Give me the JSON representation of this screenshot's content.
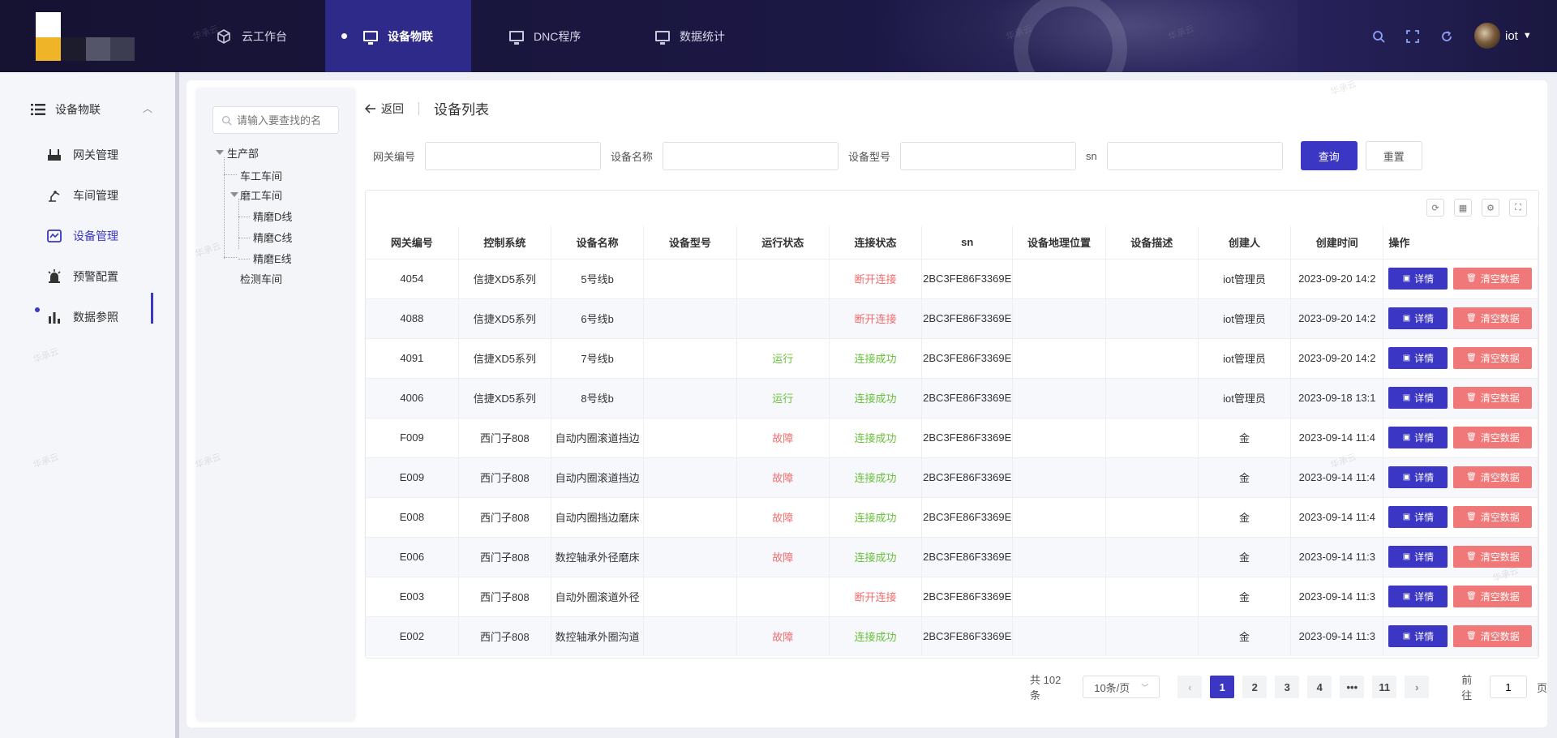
{
  "header": {
    "nav": [
      {
        "label": "云工作台",
        "icon": "cube-icon"
      },
      {
        "label": "设备物联",
        "icon": "monitor-icon",
        "active": true
      },
      {
        "label": "DNC程序",
        "icon": "monitor-icon"
      },
      {
        "label": "数据统计",
        "icon": "monitor-icon"
      }
    ],
    "icons": [
      "search-icon",
      "fullscreen-icon",
      "refresh-icon"
    ],
    "user": "iot"
  },
  "sidebar": {
    "group": "设备物联",
    "items": [
      {
        "label": "网关管理",
        "icon": "gateway-icon"
      },
      {
        "label": "车间管理",
        "icon": "robot-arm-icon"
      },
      {
        "label": "设备管理",
        "icon": "device-icon",
        "active": true
      },
      {
        "label": "预警配置",
        "icon": "alarm-icon"
      },
      {
        "label": "数据参照",
        "icon": "bar-chart-icon"
      }
    ]
  },
  "tree": {
    "search_placeholder": "请输入要查找的名",
    "nodes": [
      "生产部",
      "车工车间",
      "磨工车间",
      "精磨D线",
      "精磨C线",
      "精磨E线",
      "检测车间"
    ]
  },
  "breadcrumb": {
    "back": "返回",
    "title": "设备列表"
  },
  "filters": {
    "gateway_no": "网关编号",
    "device_name": "设备名称",
    "device_model": "设备型号",
    "sn": "sn",
    "query": "查询",
    "reset": "重置"
  },
  "table": {
    "columns": [
      "网关编号",
      "控制系统",
      "设备名称",
      "设备型号",
      "运行状态",
      "连接状态",
      "sn",
      "设备地理位置",
      "设备描述",
      "创建人",
      "创建时间",
      "操作"
    ],
    "detail_label": "详情",
    "clear_label": "清空数据",
    "rows": [
      {
        "gateway": "4054",
        "control": "信捷XD5系列",
        "name": "5号线b",
        "model": "",
        "run": "",
        "conn": "断开连接",
        "sn": "2BC3FE86F3369E",
        "location": "",
        "desc": "",
        "creator": "iot管理员",
        "created": "2023-09-20 14:2"
      },
      {
        "gateway": "4088",
        "control": "信捷XD5系列",
        "name": "6号线b",
        "model": "",
        "run": "",
        "conn": "断开连接",
        "sn": "2BC3FE86F3369E",
        "location": "",
        "desc": "",
        "creator": "iot管理员",
        "created": "2023-09-20 14:2"
      },
      {
        "gateway": "4091",
        "control": "信捷XD5系列",
        "name": "7号线b",
        "model": "",
        "run": "运行",
        "conn": "连接成功",
        "sn": "2BC3FE86F3369E",
        "location": "",
        "desc": "",
        "creator": "iot管理员",
        "created": "2023-09-20 14:2"
      },
      {
        "gateway": "4006",
        "control": "信捷XD5系列",
        "name": "8号线b",
        "model": "",
        "run": "运行",
        "conn": "连接成功",
        "sn": "2BC3FE86F3369E",
        "location": "",
        "desc": "",
        "creator": "iot管理员",
        "created": "2023-09-18 13:1"
      },
      {
        "gateway": "F009",
        "control": "西门子808",
        "name": "自动内圈滚道挡边",
        "model": "",
        "run": "故障",
        "conn": "连接成功",
        "sn": "2BC3FE86F3369E",
        "location": "",
        "desc": "",
        "creator": "金",
        "created": "2023-09-14 11:4"
      },
      {
        "gateway": "E009",
        "control": "西门子808",
        "name": "自动内圈滚道挡边",
        "model": "",
        "run": "故障",
        "conn": "连接成功",
        "sn": "2BC3FE86F3369E",
        "location": "",
        "desc": "",
        "creator": "金",
        "created": "2023-09-14 11:4"
      },
      {
        "gateway": "E008",
        "control": "西门子808",
        "name": "自动内圈挡边磨床",
        "model": "",
        "run": "故障",
        "conn": "连接成功",
        "sn": "2BC3FE86F3369E",
        "location": "",
        "desc": "",
        "creator": "金",
        "created": "2023-09-14 11:4"
      },
      {
        "gateway": "E006",
        "control": "西门子808",
        "name": "数控轴承外径磨床",
        "model": "",
        "run": "故障",
        "conn": "连接成功",
        "sn": "2BC3FE86F3369E",
        "location": "",
        "desc": "",
        "creator": "金",
        "created": "2023-09-14 11:3"
      },
      {
        "gateway": "E003",
        "control": "西门子808",
        "name": "自动外圈滚道外径",
        "model": "",
        "run": "",
        "conn": "断开连接",
        "sn": "2BC3FE86F3369E",
        "location": "",
        "desc": "",
        "creator": "金",
        "created": "2023-09-14 11:3"
      },
      {
        "gateway": "E002",
        "control": "西门子808",
        "name": "数控轴承外圈沟道",
        "model": "",
        "run": "故障",
        "conn": "连接成功",
        "sn": "2BC3FE86F3369E",
        "location": "",
        "desc": "",
        "creator": "金",
        "created": "2023-09-14 11:3"
      }
    ]
  },
  "pagination": {
    "total": "共 102 条",
    "page_size": "10条/页",
    "pages": [
      "1",
      "2",
      "3",
      "4",
      "•••",
      "11"
    ],
    "current": "1",
    "goto_label": "前往",
    "goto_value": "1",
    "page_suffix": "页"
  },
  "watermark": "华承云",
  "colors": {
    "primary": "#3b36c4",
    "danger": "#f17878",
    "success": "#67c23a",
    "error_text": "#f56c6c",
    "header_bg": "#151232"
  }
}
